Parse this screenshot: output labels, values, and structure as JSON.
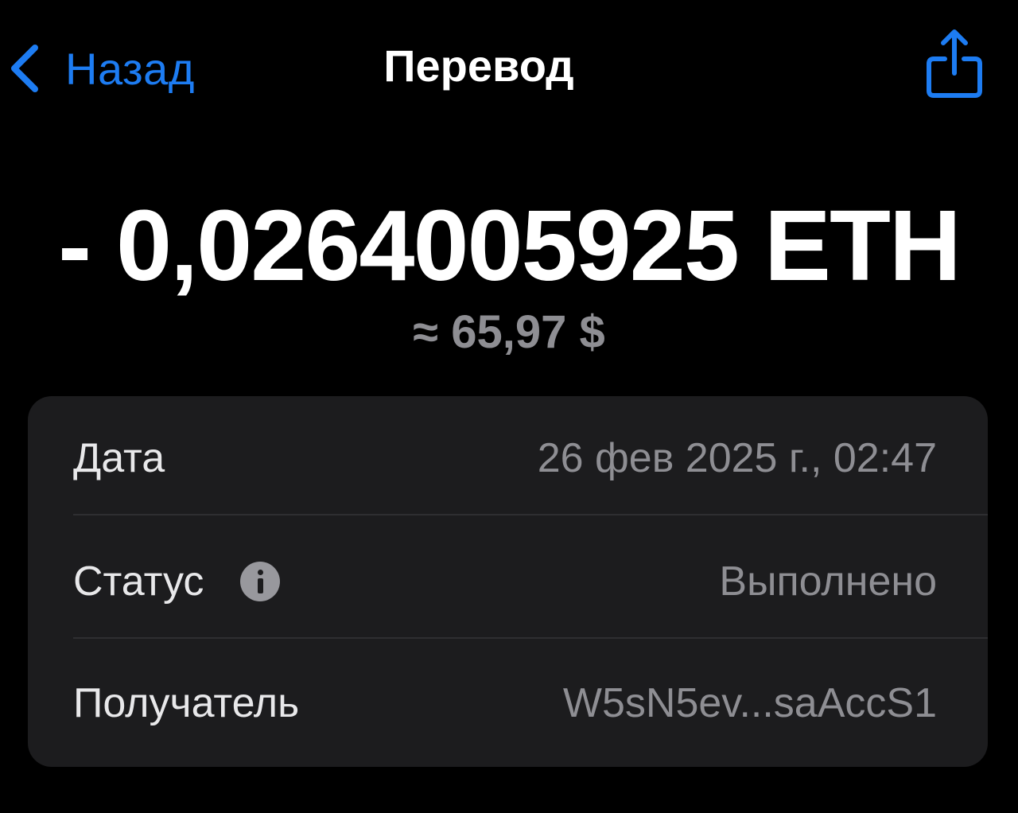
{
  "nav": {
    "back_label": "Назад",
    "back_icon": "chevron-left-icon",
    "title": "Перевод",
    "share_icon": "share-icon",
    "accent_color": "#1d7cf2"
  },
  "transaction": {
    "amount": "- 0,0264005925 ETH",
    "fiat_value": "≈ 65,97 $"
  },
  "details": {
    "date": {
      "label": "Дата",
      "value": "26 фев 2025 г., 02:47"
    },
    "status": {
      "label": "Статус",
      "value": "Выполнено",
      "info_icon": "info-icon"
    },
    "recipient": {
      "label": "Получатель",
      "value": "W5sN5ev...saAccS1"
    }
  }
}
